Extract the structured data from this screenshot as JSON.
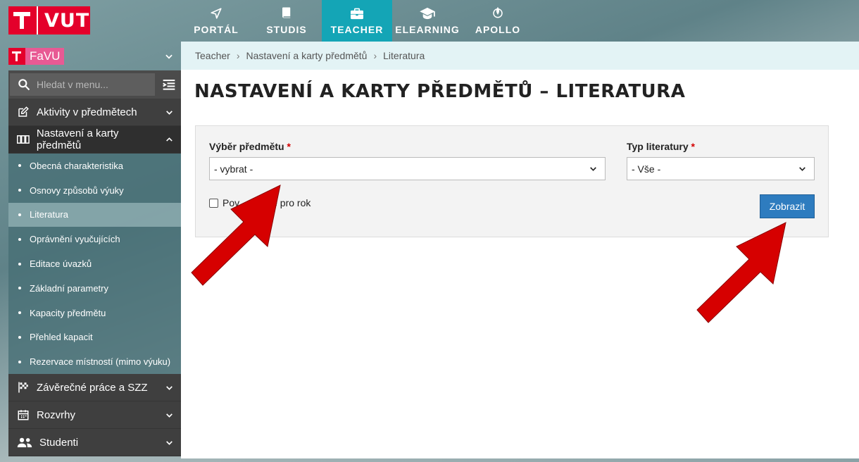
{
  "brand": {
    "logo_text": "VUT"
  },
  "topnav": [
    {
      "label": "PORTÁL",
      "icon": "navigation-arrow-icon",
      "active": false
    },
    {
      "label": "STUDIS",
      "icon": "book-icon",
      "active": false
    },
    {
      "label": "TEACHER",
      "icon": "briefcase-icon",
      "active": true
    },
    {
      "label": "ELEARNING",
      "icon": "graduation-cap-icon",
      "active": false
    },
    {
      "label": "APOLLO",
      "icon": "rocket-icon",
      "active": false
    }
  ],
  "faculty": {
    "name": "FaVU"
  },
  "search": {
    "placeholder": "Hledat v menu..."
  },
  "sidebar": {
    "items": [
      {
        "label": "Aktivity v předmětech",
        "icon": "edit-icon"
      },
      {
        "label": "Nastavení a karty předmětů",
        "icon": "cards-icon"
      },
      {
        "label": "Závěrečné práce a SZZ",
        "icon": "checkered-flag-icon"
      },
      {
        "label": "Rozvrhy",
        "icon": "calendar-icon"
      },
      {
        "label": "Studenti",
        "icon": "users-icon"
      }
    ],
    "subitems": [
      "Obecná charakteristika",
      "Osnovy způsobů výuky",
      "Literatura",
      "Oprávnění vyučujících",
      "Editace úvazků",
      "Základní parametry",
      "Kapacity předmětu",
      "Přehled kapacit",
      "Rezervace místností (mimo výuku)"
    ],
    "active_sub": "Literatura"
  },
  "breadcrumb": [
    "Teacher",
    "Nastavení a karty předmětů",
    "Literatura"
  ],
  "page": {
    "title": "NASTAVENÍ A KARTY PŘEDMĚTŮ – LITERATURA"
  },
  "form": {
    "subject_label": "Výběr předmětu",
    "subject_value": "- vybrat -",
    "lit_type_label": "Typ literatury",
    "lit_type_value": "- Vše -",
    "required_mark": "*",
    "checkbox_label": "Povinné pouze pro rok",
    "checkbox_visible_fragment_left": "Pov",
    "checkbox_visible_fragment_right": "é pro rok",
    "submit_label": "Zobrazit"
  },
  "colors": {
    "brand_red": "#e4002b",
    "accent_teal": "#14a5b6",
    "button_blue": "#2e7cbf",
    "arrow_red": "#d60000"
  }
}
